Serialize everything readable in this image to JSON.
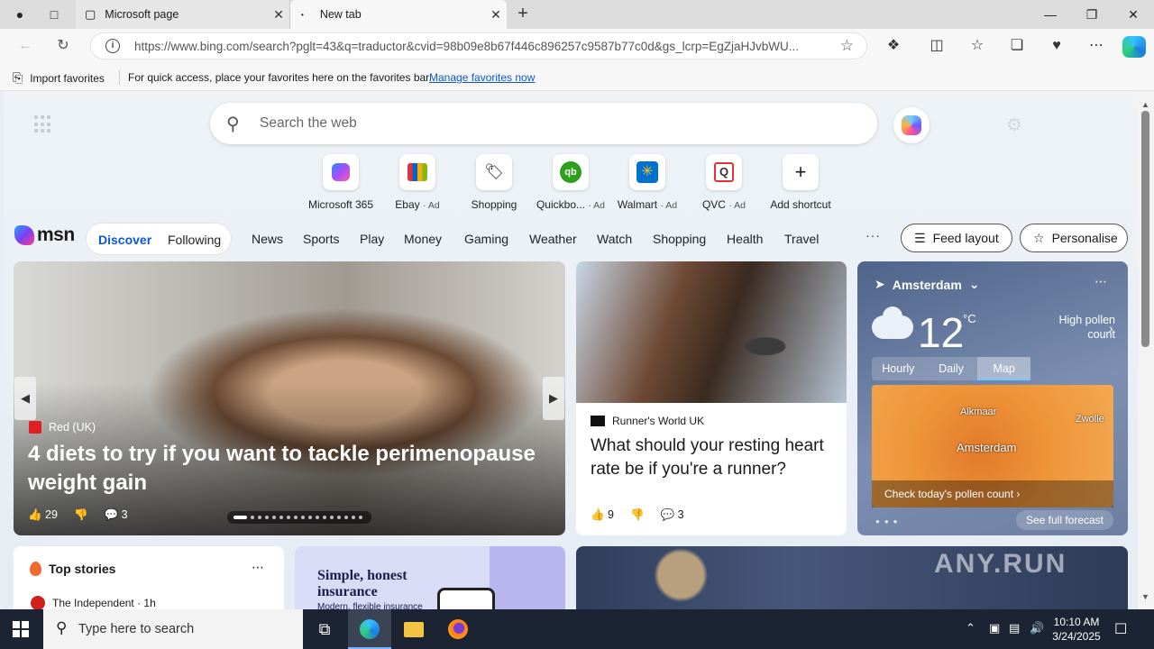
{
  "browser": {
    "tabs": [
      {
        "title": "Microsoft page",
        "active": false
      },
      {
        "title": "New tab",
        "active": true
      }
    ],
    "url_host": "https://www.bing.com",
    "url_rest": "/search?pglt=43&q=traductor&cvid=98b09e8b67f446c896257c9587b77c0d&gs_lcrp=EgZjaHJvbWU..."
  },
  "favorites_bar": {
    "import_label": "Import favorites",
    "message": "For quick access, place your favorites here on the favorites bar.",
    "manage_link": "Manage favorites now"
  },
  "search": {
    "placeholder": "Search the web"
  },
  "shortcuts": [
    {
      "label": "Microsoft 365",
      "ad": ""
    },
    {
      "label": "Ebay",
      "ad": "· Ad"
    },
    {
      "label": "Shopping",
      "ad": ""
    },
    {
      "label": "Quickbo...",
      "ad": "· Ad"
    },
    {
      "label": "Walmart",
      "ad": "· Ad"
    },
    {
      "label": "QVC",
      "ad": "· Ad"
    },
    {
      "label": "Add shortcut",
      "ad": ""
    }
  ],
  "msn": {
    "logo": "msn",
    "discover": "Discover",
    "following": "Following",
    "nav": [
      "News",
      "Sports",
      "Play",
      "Money",
      "Gaming",
      "Weather",
      "Watch",
      "Shopping",
      "Health",
      "Travel"
    ],
    "more": "···",
    "feed_layout": "Feed layout",
    "personalise": "Personalise"
  },
  "hero": {
    "source": "Red (UK)",
    "headline": "4 diets to try if you want to tackle perimenopause weight gain",
    "likes": "29",
    "comments": "3"
  },
  "card2": {
    "source": "Runner's World UK",
    "headline": "What should your resting heart rate be if you're a runner?",
    "likes": "9",
    "comments": "3"
  },
  "weather": {
    "location": "Amsterdam",
    "temp": "12",
    "unit": "°C",
    "pollen": "High pollen count",
    "tabs": [
      "Hourly",
      "Daily",
      "Map"
    ],
    "selected_tab": "Map",
    "map_labels": [
      "Alkmaar",
      "Zwolle",
      "Amsterdam"
    ],
    "pollen_link": "Check today's pollen count ›",
    "forecast": "See full forecast"
  },
  "top_stories": {
    "title": "Top stories",
    "first_source": "The Independent · 1h"
  },
  "ad": {
    "title": "Simple, honest insurance",
    "subtitle": "Modern, flexible insurance"
  },
  "watermark": "ANY.RUN",
  "taskbar": {
    "search_placeholder": "Type here to search",
    "time": "10:10 AM",
    "date": "3/24/2025"
  }
}
